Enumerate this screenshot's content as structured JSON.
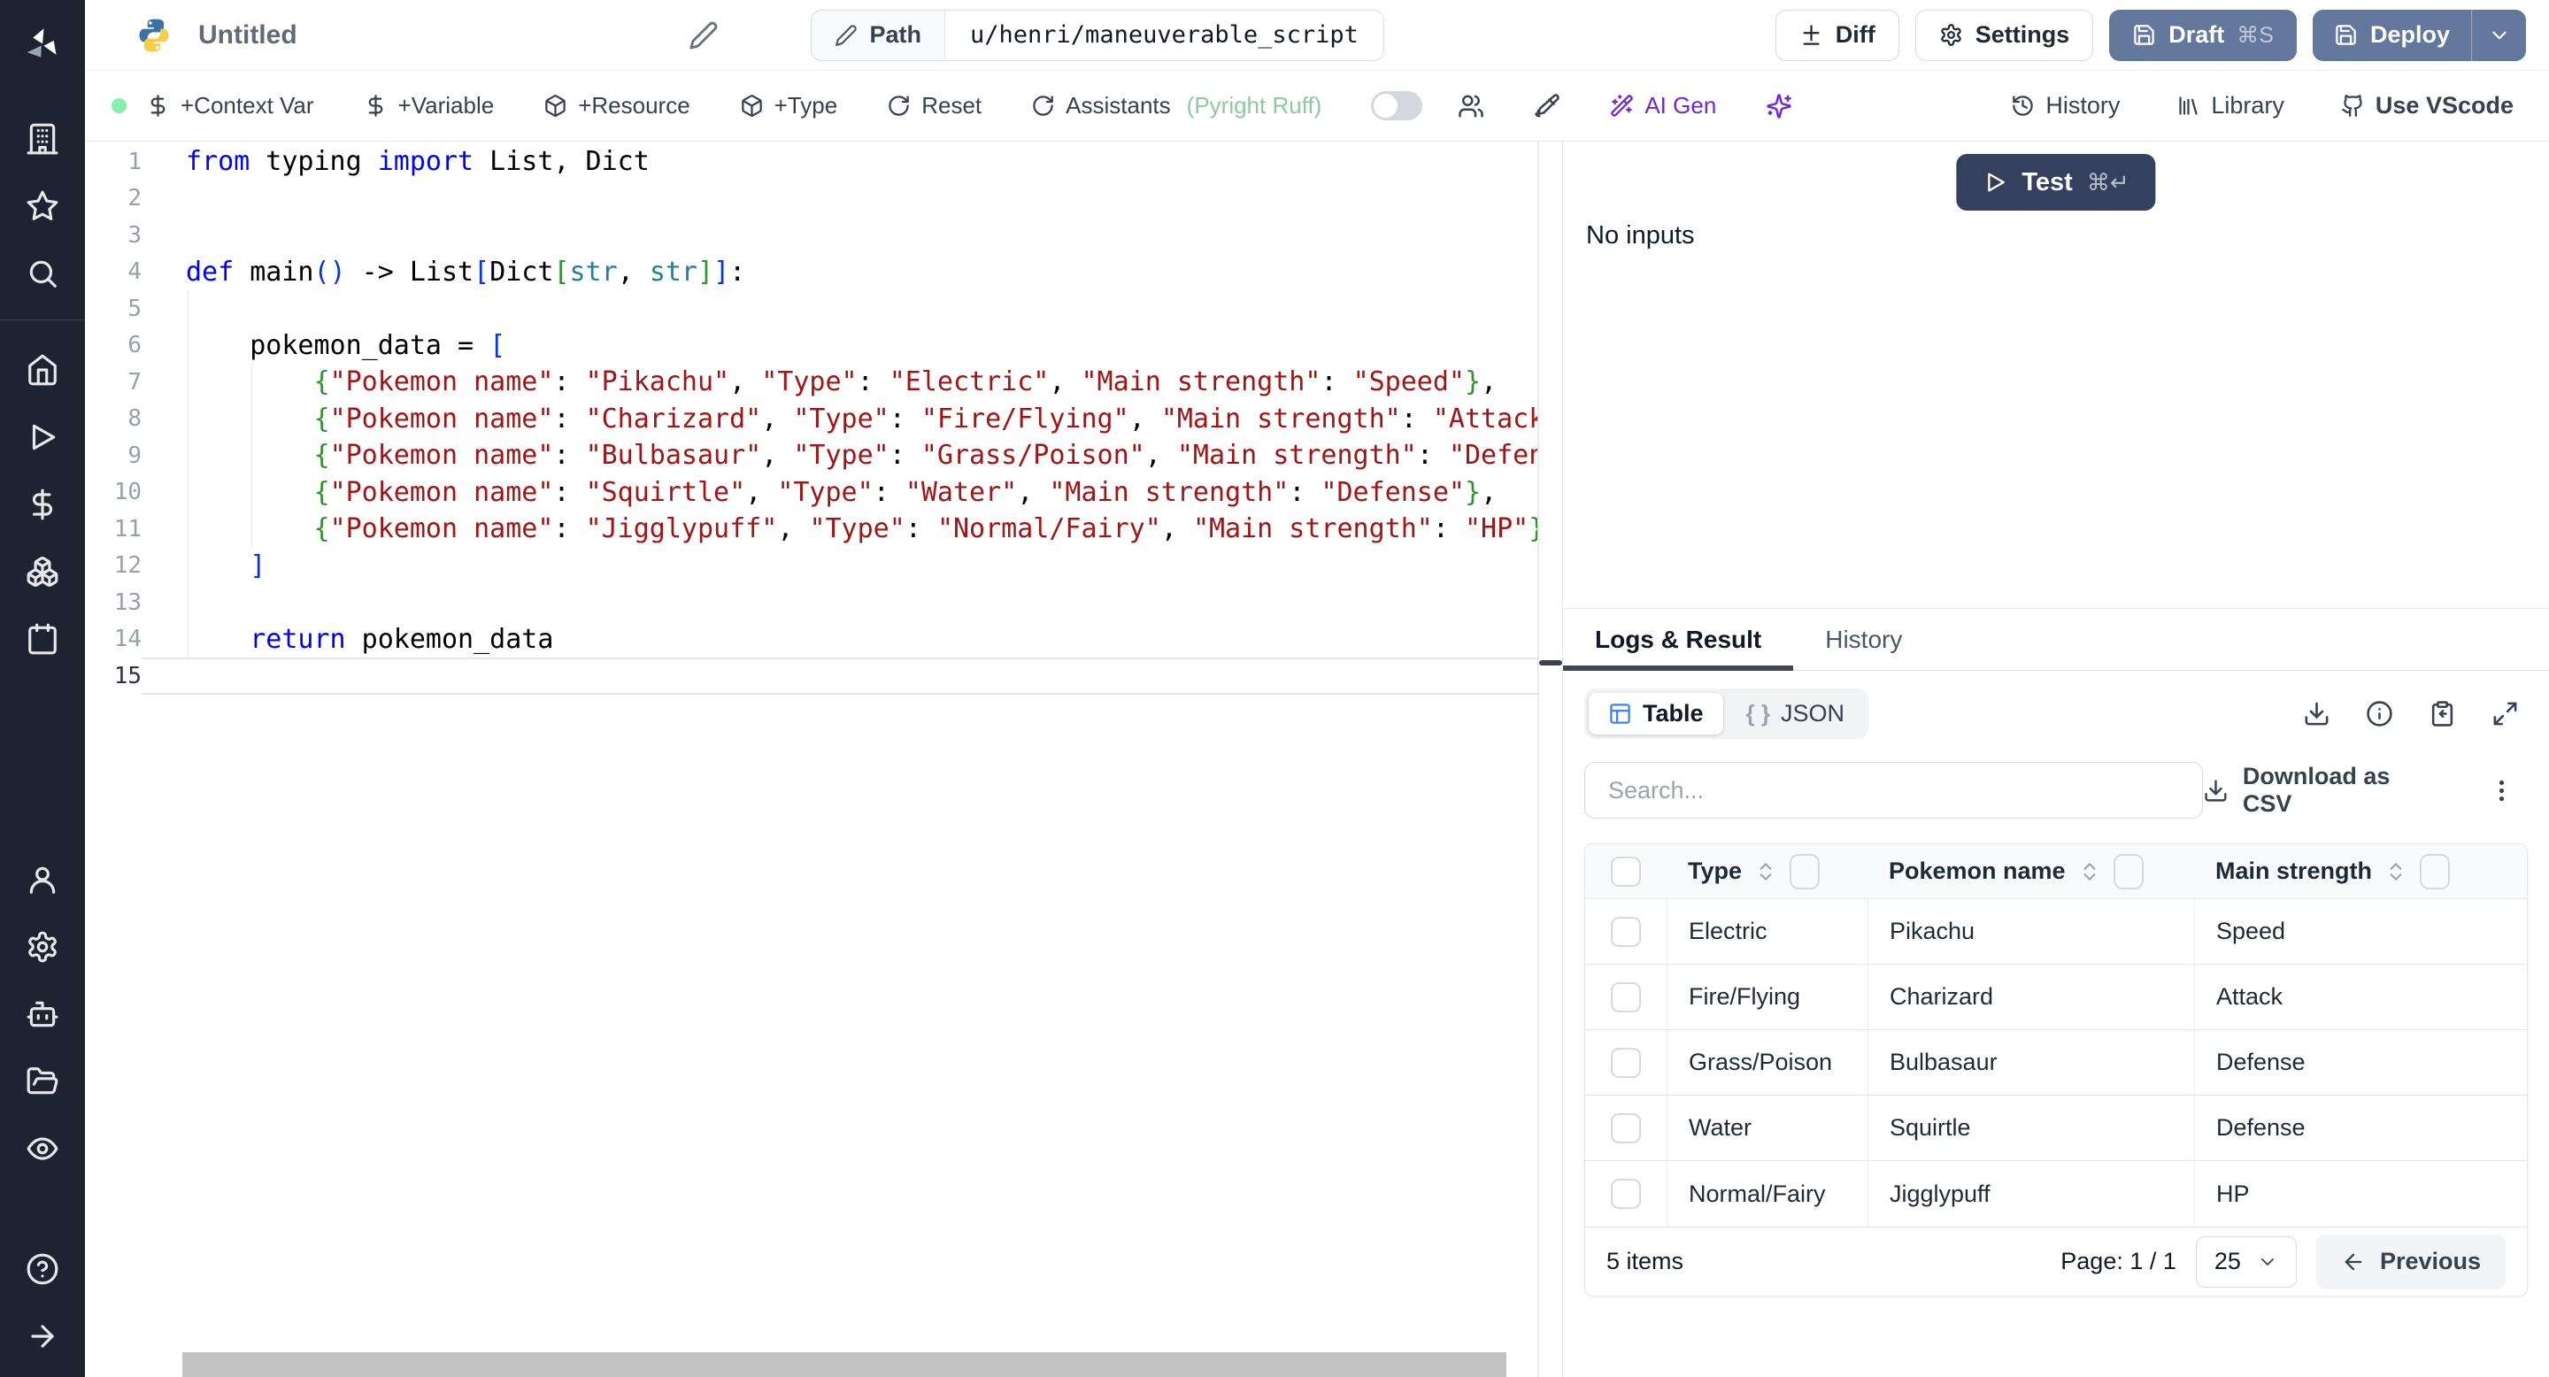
{
  "colors": {
    "accent_slate": "#64779c",
    "btn_dark": "#33415e",
    "green_dot": "#86efac",
    "purple": "#6d28d9",
    "code": {
      "kw": "#0000ff",
      "str": "#a31515",
      "b1": "#0431fa",
      "b2": "#319331",
      "ty": "#267f99",
      "pl": "#000000"
    }
  },
  "sidebar": {
    "icons": [
      "windmill-logo",
      "building",
      "star",
      "search",
      "home",
      "play",
      "dollar",
      "boxes",
      "calendar",
      "user",
      "gear",
      "robot",
      "folder-open",
      "eye",
      "help",
      "arrow-right"
    ]
  },
  "topbar": {
    "title": "Untitled",
    "path_label": "Path",
    "path_value": "u/henri/maneuverable_script",
    "diff_label": "Diff",
    "settings_label": "Settings",
    "draft_label": "Draft",
    "draft_shortcut": "⌘S",
    "deploy_label": "Deploy"
  },
  "toolbar": {
    "context_var": "+Context Var",
    "variable": "+Variable",
    "resource": "+Resource",
    "type": "+Type",
    "reset": "Reset",
    "assistants": "Assistants",
    "assistants_note": "(Pyright Ruff)",
    "ai_gen": "AI Gen",
    "history": "History",
    "library": "Library",
    "vscode": "Use VScode"
  },
  "editor": {
    "lines": [
      {
        "n": 1,
        "tokens": [
          [
            "from",
            "kw"
          ],
          [
            " typing ",
            "pl"
          ],
          [
            "import",
            "kw"
          ],
          [
            " List, Dict",
            "pl"
          ]
        ]
      },
      {
        "n": 2,
        "tokens": []
      },
      {
        "n": 3,
        "tokens": []
      },
      {
        "n": 4,
        "tokens": [
          [
            "def",
            "kw"
          ],
          [
            " main",
            "pl"
          ],
          [
            "(",
            "b1"
          ],
          [
            ")",
            "b1"
          ],
          [
            " -> List",
            "pl"
          ],
          [
            "[",
            "b1"
          ],
          [
            "Dict",
            "pl"
          ],
          [
            "[",
            "b2"
          ],
          [
            "str",
            "ty"
          ],
          [
            ", ",
            "pl"
          ],
          [
            "str",
            "ty"
          ],
          [
            "]",
            "b2"
          ],
          [
            "]",
            "b1"
          ],
          [
            ":",
            "pl"
          ]
        ]
      },
      {
        "n": 5,
        "tokens": []
      },
      {
        "n": 6,
        "tokens": [
          [
            "    pokemon_data = ",
            "pl"
          ],
          [
            "[",
            "b1"
          ]
        ]
      },
      {
        "n": 7,
        "tokens": [
          [
            "        ",
            "pl"
          ],
          [
            "{",
            "b2"
          ],
          [
            "\"Pokemon name\"",
            "str"
          ],
          [
            ": ",
            "pl"
          ],
          [
            "\"Pikachu\"",
            "str"
          ],
          [
            ", ",
            "pl"
          ],
          [
            "\"Type\"",
            "str"
          ],
          [
            ": ",
            "pl"
          ],
          [
            "\"Electric\"",
            "str"
          ],
          [
            ", ",
            "pl"
          ],
          [
            "\"Main strength\"",
            "str"
          ],
          [
            ": ",
            "pl"
          ],
          [
            "\"Speed\"",
            "str"
          ],
          [
            "}",
            "b2"
          ],
          [
            ",",
            "pl"
          ]
        ]
      },
      {
        "n": 8,
        "tokens": [
          [
            "        ",
            "pl"
          ],
          [
            "{",
            "b2"
          ],
          [
            "\"Pokemon name\"",
            "str"
          ],
          [
            ": ",
            "pl"
          ],
          [
            "\"Charizard\"",
            "str"
          ],
          [
            ", ",
            "pl"
          ],
          [
            "\"Type\"",
            "str"
          ],
          [
            ": ",
            "pl"
          ],
          [
            "\"Fire/Flying\"",
            "str"
          ],
          [
            ", ",
            "pl"
          ],
          [
            "\"Main strength\"",
            "str"
          ],
          [
            ": ",
            "pl"
          ],
          [
            "\"Attack\"",
            "str"
          ],
          [
            "}",
            "b2"
          ],
          [
            ",",
            "pl"
          ]
        ]
      },
      {
        "n": 9,
        "tokens": [
          [
            "        ",
            "pl"
          ],
          [
            "{",
            "b2"
          ],
          [
            "\"Pokemon name\"",
            "str"
          ],
          [
            ": ",
            "pl"
          ],
          [
            "\"Bulbasaur\"",
            "str"
          ],
          [
            ", ",
            "pl"
          ],
          [
            "\"Type\"",
            "str"
          ],
          [
            ": ",
            "pl"
          ],
          [
            "\"Grass/Poison\"",
            "str"
          ],
          [
            ", ",
            "pl"
          ],
          [
            "\"Main strength\"",
            "str"
          ],
          [
            ": ",
            "pl"
          ],
          [
            "\"Defense\"",
            "str"
          ],
          [
            "}",
            "b2"
          ],
          [
            ",",
            "pl"
          ]
        ]
      },
      {
        "n": 10,
        "tokens": [
          [
            "        ",
            "pl"
          ],
          [
            "{",
            "b2"
          ],
          [
            "\"Pokemon name\"",
            "str"
          ],
          [
            ": ",
            "pl"
          ],
          [
            "\"Squirtle\"",
            "str"
          ],
          [
            ", ",
            "pl"
          ],
          [
            "\"Type\"",
            "str"
          ],
          [
            ": ",
            "pl"
          ],
          [
            "\"Water\"",
            "str"
          ],
          [
            ", ",
            "pl"
          ],
          [
            "\"Main strength\"",
            "str"
          ],
          [
            ": ",
            "pl"
          ],
          [
            "\"Defense\"",
            "str"
          ],
          [
            "}",
            "b2"
          ],
          [
            ",",
            "pl"
          ]
        ]
      },
      {
        "n": 11,
        "tokens": [
          [
            "        ",
            "pl"
          ],
          [
            "{",
            "b2"
          ],
          [
            "\"Pokemon name\"",
            "str"
          ],
          [
            ": ",
            "pl"
          ],
          [
            "\"Jigglypuff\"",
            "str"
          ],
          [
            ", ",
            "pl"
          ],
          [
            "\"Type\"",
            "str"
          ],
          [
            ": ",
            "pl"
          ],
          [
            "\"Normal/Fairy\"",
            "str"
          ],
          [
            ", ",
            "pl"
          ],
          [
            "\"Main strength\"",
            "str"
          ],
          [
            ": ",
            "pl"
          ],
          [
            "\"HP\"",
            "str"
          ],
          [
            "}",
            "b2"
          ],
          [
            ",",
            "pl"
          ]
        ]
      },
      {
        "n": 12,
        "tokens": [
          [
            "    ",
            "pl"
          ],
          [
            "]",
            "b1"
          ]
        ]
      },
      {
        "n": 13,
        "tokens": []
      },
      {
        "n": 14,
        "tokens": [
          [
            "    ",
            "pl"
          ],
          [
            "return",
            "kw"
          ],
          [
            " pokemon_data",
            "pl"
          ]
        ]
      },
      {
        "n": 15,
        "tokens": [],
        "current": true
      }
    ]
  },
  "panel": {
    "test_label": "Test",
    "test_shortcut": "⌘↵",
    "no_inputs": "No inputs",
    "tabs": [
      {
        "label": "Logs & Result",
        "active": true
      },
      {
        "label": "History",
        "active": false
      }
    ],
    "view_toggle": {
      "table_label": "Table",
      "json_label": "JSON",
      "json_braces": "{ }"
    },
    "search_placeholder": "Search...",
    "download_csv_label": "Download as CSV",
    "table": {
      "columns": [
        "Type",
        "Pokemon name",
        "Main strength"
      ],
      "rows": [
        [
          "Electric",
          "Pikachu",
          "Speed"
        ],
        [
          "Fire/Flying",
          "Charizard",
          "Attack"
        ],
        [
          "Grass/Poison",
          "Bulbasaur",
          "Defense"
        ],
        [
          "Water",
          "Squirtle",
          "Defense"
        ],
        [
          "Normal/Fairy",
          "Jigglypuff",
          "HP"
        ]
      ],
      "footer": {
        "items_text": "5 items",
        "page_text": "Page: 1 / 1",
        "page_size": "25",
        "previous_label": "Previous"
      }
    }
  }
}
